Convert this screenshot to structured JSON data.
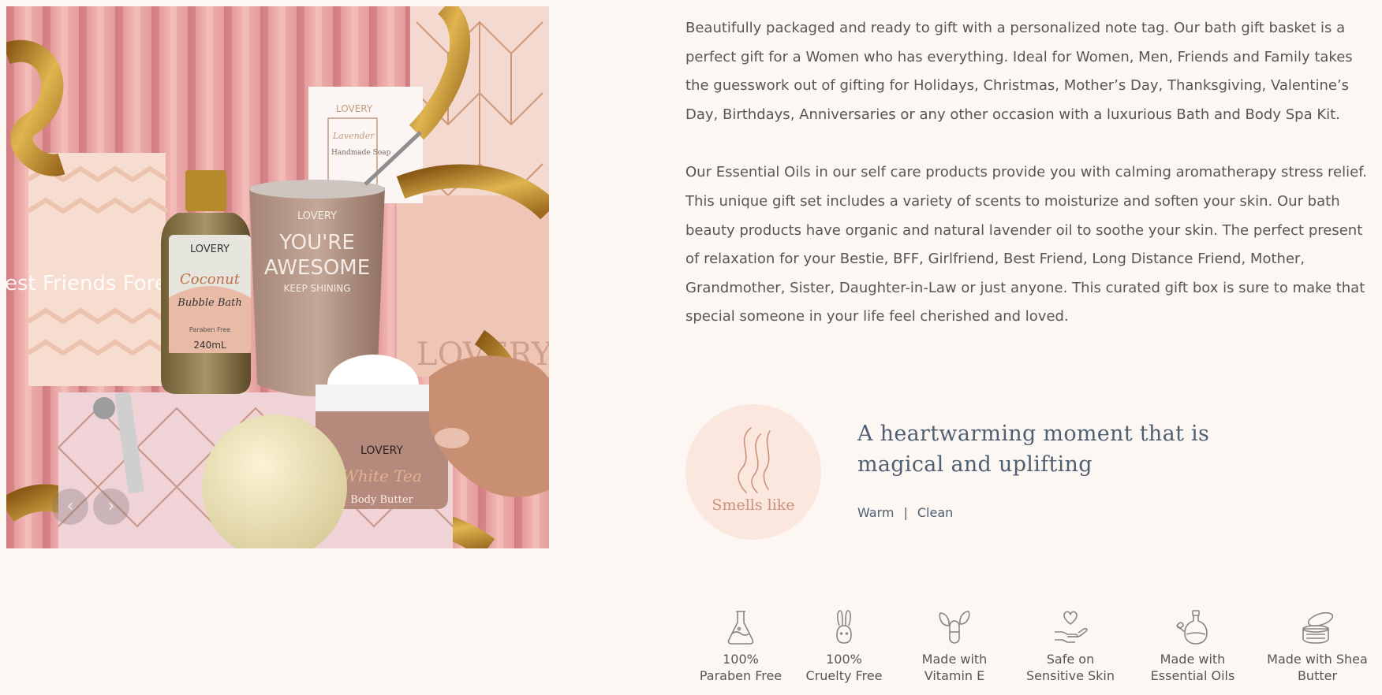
{
  "gallery": {
    "prev_icon": "chevron-left-icon",
    "next_icon": "chevron-right-icon",
    "prev_glyph": "‹",
    "next_glyph": "›",
    "packaging_text": "Best Friends Forever",
    "brand": "LOVERY",
    "mug_text_line1": "YOU'RE",
    "mug_text_line2": "AWESOME",
    "mug_text_line3": "KEEP SHINING",
    "bottle_scent": "Coconut",
    "bottle_product": "Bubble Bath",
    "bottle_note": "Paraben Free",
    "bottle_size": "240mL",
    "soap_scent": "Lavender",
    "soap_product": "Handmade Soap",
    "jar_scent": "White Tea",
    "jar_product": "Body Butter",
    "bag_brand": "LOVERY"
  },
  "description": {
    "paragraph1": "Beautifully packaged and ready to gift with a personalized note tag. Our bath gift basket is a perfect gift for a Women who has everything. Ideal for Women, Men, Friends and Family takes the guesswork out of gifting for Holidays, Christmas, Mother’s Day, Thanksgiving, Valentine’s Day, Birthdays, Anniversaries or any other occasion with a luxurious Bath and Body Spa Kit.",
    "paragraph2": "Our Essential Oils in our self care products provide you with calming aromatherapy stress relief. This unique gift set includes a variety of scents to moisturize and soften your skin. Our bath beauty products have organic and natural lavender oil to soothe your skin. The perfect present of relaxation for your Bestie, BFF, Girlfriend, Best Friend, Long Distance Friend, Mother, Grandmother, Sister, Daughter-in-Law or just anyone. This curated gift box is sure to make that special someone in your life feel cherished and loved."
  },
  "scent": {
    "icon": "scent-wave-icon",
    "label": "Smells like",
    "tagline": "A heartwarming moment that is magical and uplifting",
    "notes": [
      "Warm",
      "Clean"
    ],
    "separator": "|"
  },
  "features": [
    {
      "icon": "flask-icon",
      "line1": "100%",
      "line2": "Paraben Free"
    },
    {
      "icon": "bunny-icon",
      "line1": "100%",
      "line2": "Cruelty Free"
    },
    {
      "icon": "capsule-leaf-icon",
      "line1": "Made with",
      "line2": "Vitamin E"
    },
    {
      "icon": "heart-hand-icon",
      "line1": "Safe on",
      "line2": "Sensitive Skin"
    },
    {
      "icon": "oil-bottle-icon",
      "line1": "Made with",
      "line2": "Essential Oils"
    },
    {
      "icon": "butter-jar-icon",
      "line1": "Made with Shea",
      "line2": "Butter"
    }
  ],
  "colors": {
    "background": "#fdf7f3",
    "body_text": "#5b5552",
    "accent_blue": "#4e5f72",
    "blush": "#fbe7dd",
    "rose_gold": "#c9917e"
  }
}
